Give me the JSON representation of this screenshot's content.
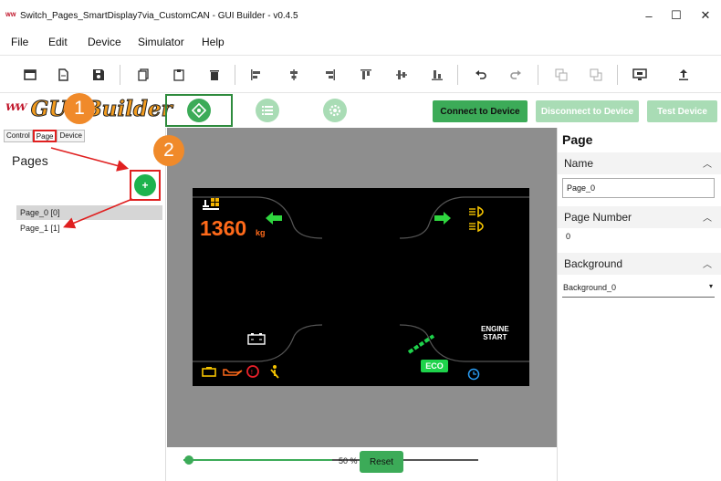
{
  "window": {
    "title": "Switch_Pages_SmartDisplay7via_CustomCAN - GUI Builder - v0.4.5",
    "minimize": "–",
    "maximize": "☐",
    "close": "✕"
  },
  "menu": [
    "File",
    "Edit",
    "Device",
    "Simulator",
    "Help"
  ],
  "toolbar": {
    "icons": [
      "new-window-icon",
      "new-file-icon",
      "save-icon",
      "copy-icon",
      "paste-icon",
      "delete-icon",
      "align-left-icon",
      "align-center-h-icon",
      "align-right-icon",
      "align-top-icon",
      "align-center-v-icon",
      "align-bottom-icon",
      "undo-icon",
      "redo-icon",
      "bring-front-icon",
      "send-back-icon",
      "preview-icon",
      "upload-icon"
    ]
  },
  "logo": {
    "text": "GUI Builder"
  },
  "header_buttons": {
    "connect": "Connect to Device",
    "disconnect": "Disconnect to Device",
    "test": "Test Device"
  },
  "colors": {
    "accent_green": "#3cab58",
    "callout_orange": "#f08a2a",
    "highlight_red": "#e02020"
  },
  "side_tabs": [
    "Control",
    "Page",
    "Device"
  ],
  "pages": {
    "title": "Pages",
    "add_label": "+",
    "items": [
      "Page_0 [0]",
      "Page_1 [1]"
    ]
  },
  "callouts": [
    "1",
    "2"
  ],
  "display": {
    "weight": "1360",
    "unit": "kg",
    "engine_start_line1": "ENGINE",
    "engine_start_line2": "START",
    "eco": "ECO"
  },
  "zoom": {
    "value": "50 %",
    "level": 0.5,
    "reset": "Reset"
  },
  "properties": {
    "heading": "Page",
    "name_label": "Name",
    "name_value": "Page_0",
    "page_number_label": "Page Number",
    "page_number_value": "0",
    "background_label": "Background",
    "background_value": "Background_0"
  }
}
